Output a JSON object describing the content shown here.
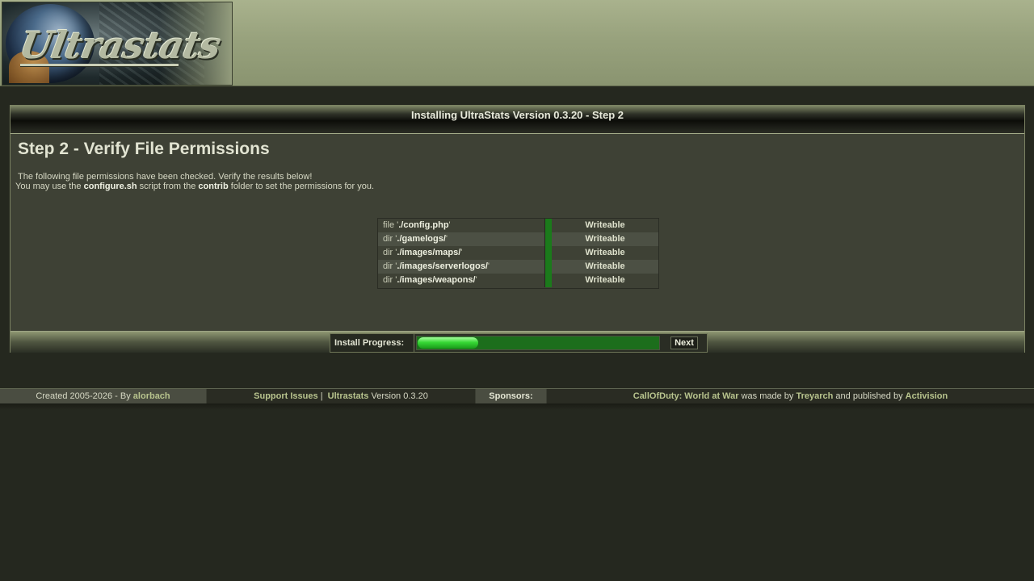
{
  "header": {
    "logo_text": "Ultrastats"
  },
  "panel": {
    "title": "Installing UltraStats Version 0.3.20 - Step 2",
    "step_title": "Step 2 - Verify File Permissions",
    "info_line1": "The following file permissions have been checked. Verify the results below!",
    "info_line2_prefix": "You may use the ",
    "info_line2_script": "configure.sh",
    "info_line2_mid": " script from the ",
    "info_line2_folder": "contrib",
    "info_line2_suffix": " folder to set the permissions for you."
  },
  "permissions": [
    {
      "kind": "file",
      "path": "./config.php",
      "status": "Writeable"
    },
    {
      "kind": "dir",
      "path": "./gamelogs/",
      "status": "Writeable"
    },
    {
      "kind": "dir",
      "path": "./images/maps/",
      "status": "Writeable"
    },
    {
      "kind": "dir",
      "path": "./images/serverlogos/",
      "status": "Writeable"
    },
    {
      "kind": "dir",
      "path": "./images/weapons/",
      "status": "Writeable"
    }
  ],
  "progress": {
    "label": "Install Progress:",
    "fraction": 0.25,
    "next_label": "Next"
  },
  "footer": {
    "created_prefix": "Created 2005-2026 - By ",
    "created_author": "alorbach",
    "support_label": "Support Issues",
    "support_sep": "|",
    "app_name": "Ultrastats",
    "app_version": "Version 0.3.20",
    "sponsors_label": "Sponsors:",
    "game_name": "CallOfDuty: World at War",
    "made_by_text": "was made by",
    "developer": "Treyarch",
    "published_text": "and published by",
    "publisher": "Activision"
  },
  "colors": {
    "status_green": "#1b7a1b",
    "progress_green": "#37d735",
    "link_color": "#b8c48e"
  }
}
